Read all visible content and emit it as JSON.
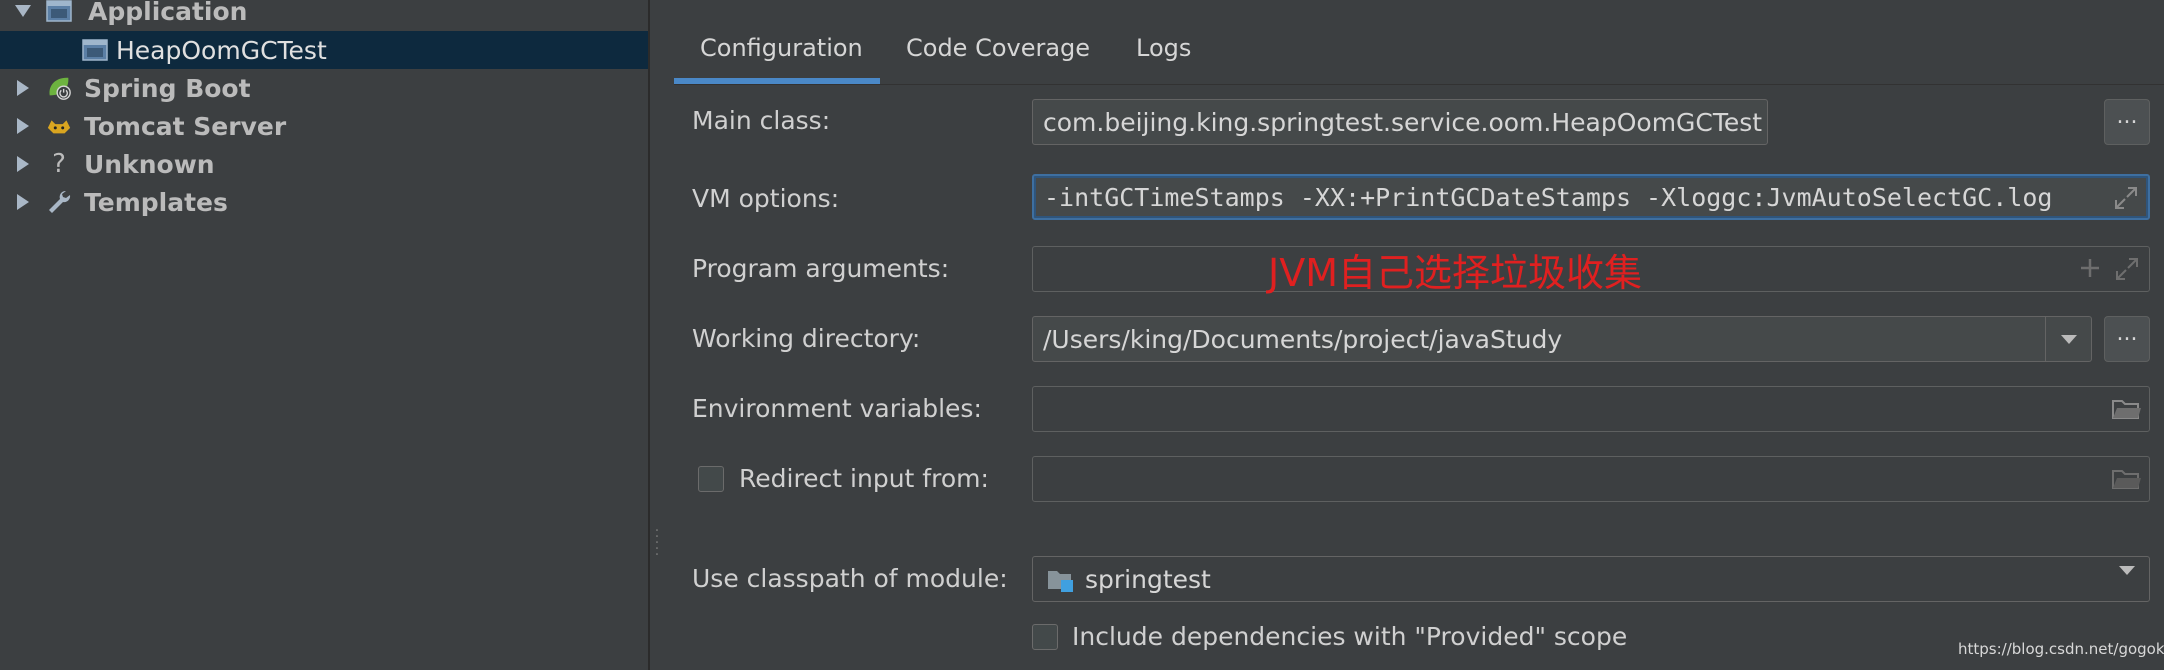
{
  "tree": {
    "items": [
      {
        "label": "Application",
        "icon": "application-icon",
        "expanded": true
      },
      {
        "label": "HeapOomGCTest",
        "icon": "run-config-icon",
        "selected": true
      },
      {
        "label": "Spring Boot",
        "icon": "spring-boot-icon"
      },
      {
        "label": "Tomcat Server",
        "icon": "tomcat-icon"
      },
      {
        "label": "Unknown",
        "icon": "question-icon"
      },
      {
        "label": "Templates",
        "icon": "wrench-icon"
      }
    ]
  },
  "tabs": [
    {
      "label": "Configuration",
      "active": true
    },
    {
      "label": "Code Coverage"
    },
    {
      "label": "Logs"
    }
  ],
  "form": {
    "main_class": {
      "label": "Main class:",
      "value": "com.beijing.king.springtest.service.oom.HeapOomGCTest",
      "button": "..."
    },
    "vm_options": {
      "label": "VM options:",
      "value": "‐intGCTimeStamps -XX:+PrintGCDateStamps -Xloggc:JvmAutoSelectGC.log"
    },
    "program_arguments": {
      "label": "Program arguments:",
      "value": ""
    },
    "working_directory": {
      "label": "Working directory:",
      "value": "/Users/king/Documents/project/javaStudy",
      "button": "..."
    },
    "environment_variables": {
      "label": "Environment variables:",
      "value": ""
    },
    "redirect_input": {
      "label": "Redirect input from:",
      "checked": false,
      "value": ""
    },
    "classpath_module": {
      "label": "Use classpath of module:",
      "value": "springtest"
    },
    "include_provided": {
      "label": "Include dependencies with \"Provided\" scope",
      "checked": false
    }
  },
  "annotation": "JVM自己选择垃圾收集",
  "watermark": "https://blog.csdn.net/gogoky",
  "colors": {
    "background": "#3c3f41",
    "selection": "#0d293e",
    "tab_underline": "#4a88c7",
    "annotation": "#e02020"
  }
}
